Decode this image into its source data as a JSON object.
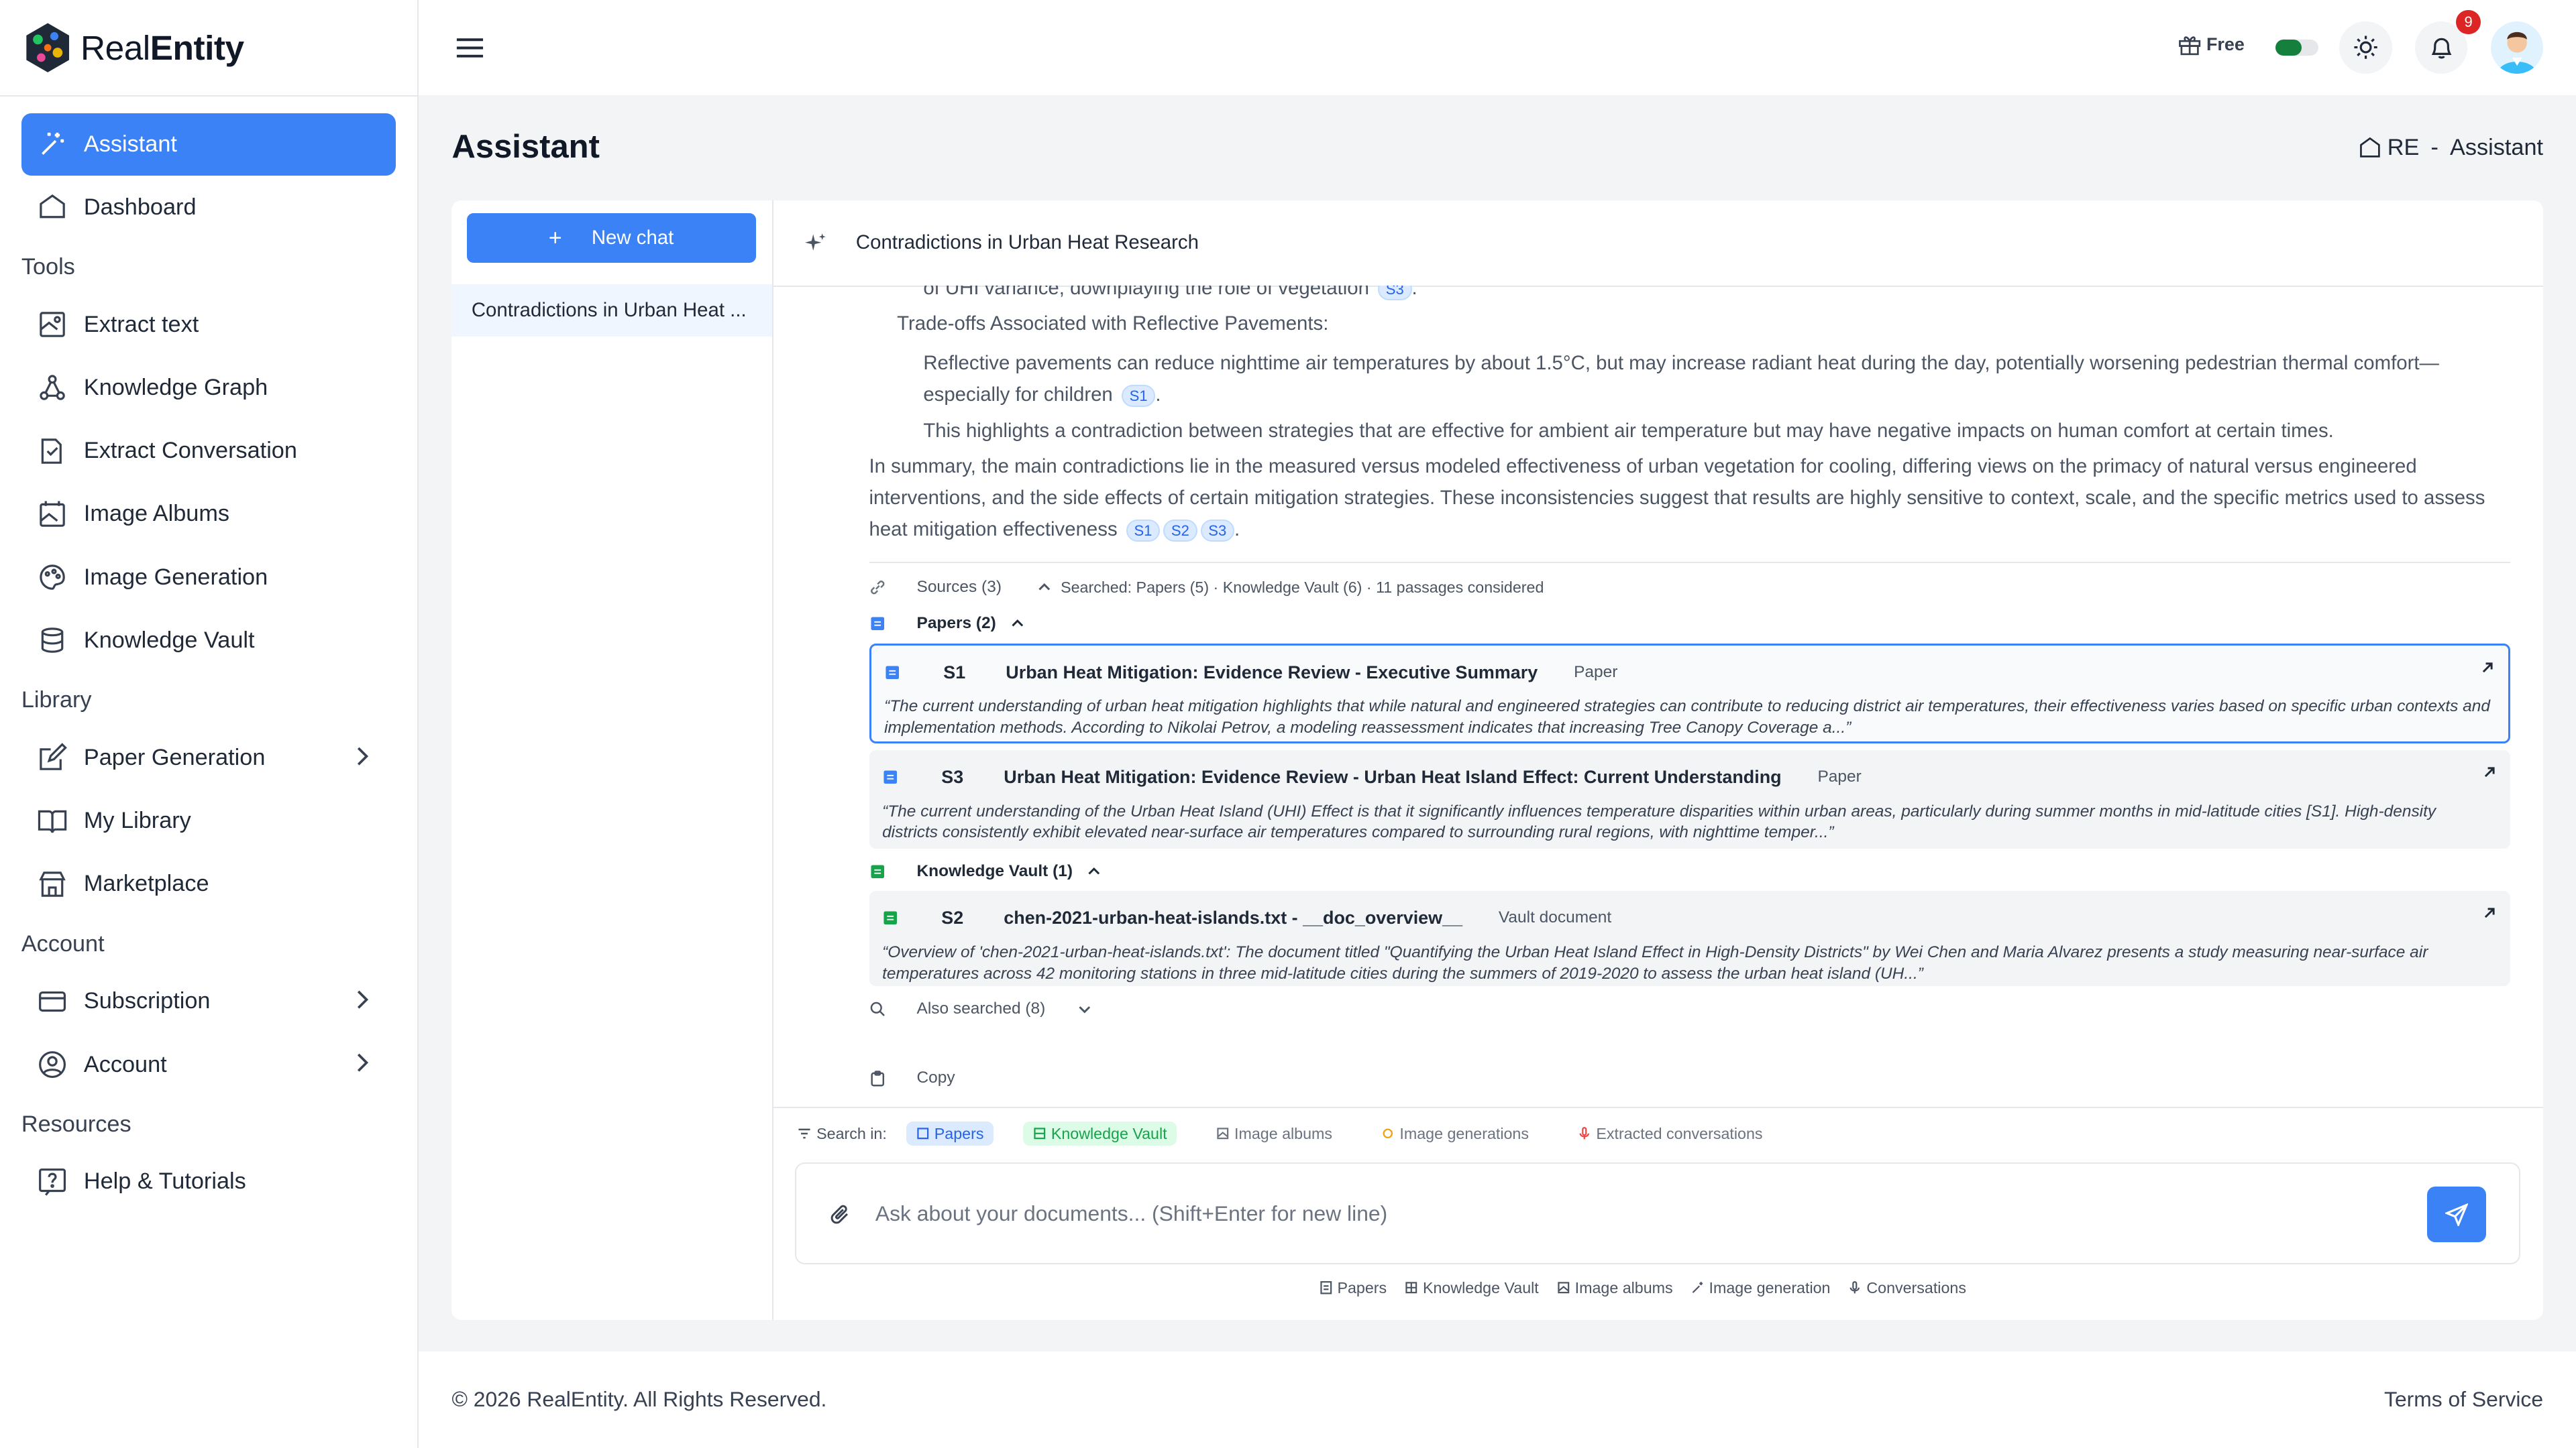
{
  "brand": {
    "name_light": "Real",
    "name_bold": "Entity"
  },
  "sidebar": {
    "assistant": "Assistant",
    "dashboard": "Dashboard",
    "sections": {
      "tools": "Tools",
      "library": "Library",
      "account": "Account",
      "resources": "Resources"
    },
    "tools": [
      "Extract text",
      "Knowledge Graph",
      "Extract Conversation",
      "Image Albums",
      "Image Generation",
      "Knowledge Vault"
    ],
    "library": [
      "Paper Generation",
      "My Library",
      "Marketplace"
    ],
    "account": [
      "Subscription",
      "Account"
    ],
    "resources": [
      "Help & Tutorials"
    ]
  },
  "topbar": {
    "plan": "Free",
    "notifications": "9"
  },
  "page": {
    "title": "Assistant",
    "breadcrumb_root": "RE",
    "breadcrumb_sep": "-",
    "breadcrumb_current": "Assistant"
  },
  "chats": {
    "new_chat": "New chat",
    "items": [
      "Contradictions in Urban Heat ..."
    ]
  },
  "conversation": {
    "title": "Contradictions in Urban Heat Research",
    "line_cut": "of UHI variance, downplaying the role of vegetation",
    "heading": "Trade-offs Associated with Reflective Pavements:",
    "p1": "Reflective pavements can reduce nighttime air temperatures by about 1.5°C, but may increase radiant heat during the day, potentially worsening pedestrian thermal comfort—especially for children",
    "p2": "This highlights a contradiction between strategies that are effective for ambient air temperature but may have negative impacts on human comfort at certain times.",
    "summary": "In summary, the main contradictions lie in the measured versus modeled effectiveness of urban vegetation for cooling, differing views on the primacy of natural versus engineered interventions, and the side effects of certain mitigation strategies. These inconsistencies suggest that results are highly sensitive to context, scale, and the specific metrics used to assess heat mitigation effectiveness",
    "cites": {
      "s1": "S1",
      "s2": "S2",
      "s3": "S3"
    }
  },
  "sources": {
    "label": "Sources (3)",
    "searched": "Searched: Papers (5) · Knowledge Vault (6) · 11 passages considered",
    "papers_label": "Papers (2)",
    "vault_label": "Knowledge Vault (1)",
    "also": "Also searched (8)",
    "copy": "Copy",
    "items": [
      {
        "id": "S1",
        "title": "Urban Heat Mitigation: Evidence Review - Executive Summary",
        "type": "Paper",
        "quote": "“The current understanding of urban heat mitigation highlights that while natural and engineered strategies can contribute to reducing district air temperatures, their effectiveness varies based on specific urban contexts and implementation methods. According to Nikolai Petrov, a modeling reassessment indicates that increasing Tree Canopy Coverage a...”"
      },
      {
        "id": "S3",
        "title": "Urban Heat Mitigation: Evidence Review - Urban Heat Island Effect: Current Understanding",
        "type": "Paper",
        "quote": "“The current understanding of the Urban Heat Island (UHI) Effect is that it significantly influences temperature disparities within urban areas, particularly during summer months in mid-latitude cities [S1]. High-density districts consistently exhibit elevated near-surface air temperatures compared to surrounding rural regions, with nighttime temper...”"
      },
      {
        "id": "S2",
        "title": "chen-2021-urban-heat-islands.txt - __doc_overview__",
        "type": "Vault document",
        "quote": "“Overview of 'chen-2021-urban-heat-islands.txt': The document titled \"Quantifying the Urban Heat Island Effect in High-Density Districts\" by Wei Chen and Maria Alvarez presents a study measuring near-surface air temperatures across 42 monitoring stations in three mid-latitude cities during the summers of 2019-2020 to assess the urban heat island (UH...”"
      }
    ]
  },
  "search_in": {
    "label": "Search in:",
    "chips": [
      "Papers",
      "Knowledge Vault",
      "Image albums",
      "Image generations",
      "Extracted conversations"
    ]
  },
  "composer": {
    "placeholder": "Ask about your documents... (Shift+Enter for new line)",
    "footer_chips": [
      "Papers",
      "Knowledge Vault",
      "Image albums",
      "Image generation",
      "Conversations"
    ]
  },
  "footer": {
    "copyright": "© 2026 RealEntity. All Rights Reserved.",
    "terms": "Terms of Service"
  },
  "colors": {
    "accent": "#3b82f6",
    "danger": "#dc2626",
    "toggle": "#15803d",
    "vault": "#16a34a"
  }
}
